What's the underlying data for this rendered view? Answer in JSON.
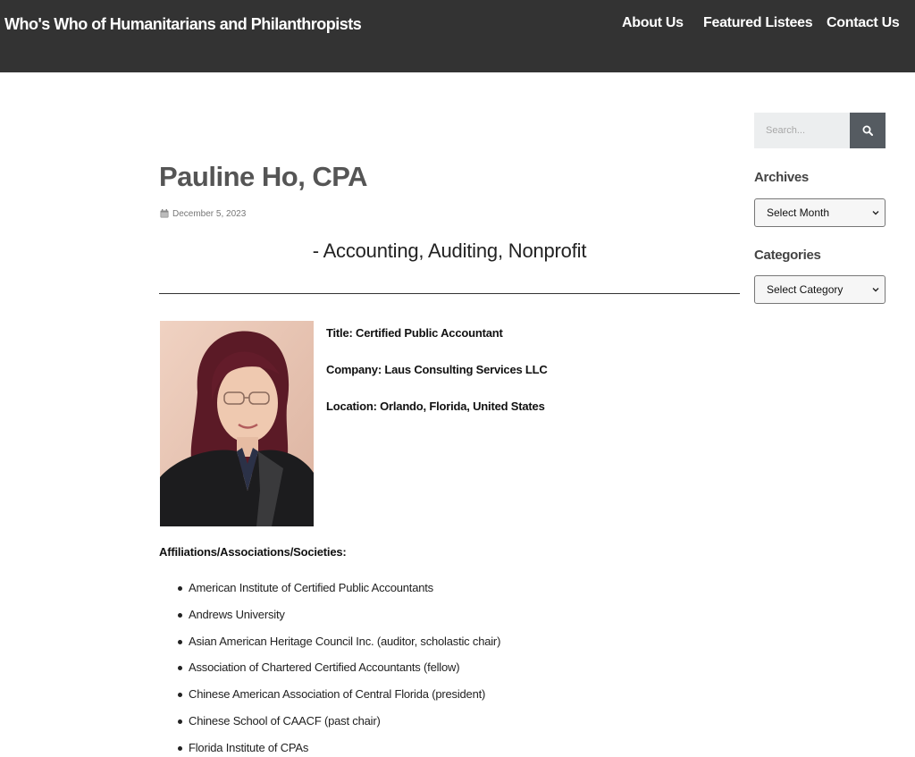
{
  "header": {
    "site_title": "Who's Who of Humanitarians and Philanthropists",
    "nav": [
      {
        "label": "About Us"
      },
      {
        "label": "Featured Listees"
      },
      {
        "label": "Contact Us"
      }
    ]
  },
  "post": {
    "title": "Pauline Ho, CPA",
    "date": "December 5, 2023",
    "date_icon": "calendar-icon",
    "subtitle": "- Accounting, Auditing, Nonprofit",
    "title_line": "Title: Certified Public Accountant",
    "company_line": "Company: Laus Consulting Services LLC",
    "location_line": "Location: Orlando, Florida, United States",
    "affiliations_heading": "Affiliations/Associations/Societies:",
    "affiliations": [
      "American Institute of Certified Public Accountants",
      "Andrews University",
      "Asian American Heritage Council Inc. (auditor, scholastic chair)",
      "Association of Chartered Certified Accountants (fellow)",
      "Chinese American Association of Central Florida (president)",
      "Chinese School of CAACF (past chair)",
      "Florida Institute of CPAs"
    ]
  },
  "sidebar": {
    "search": {
      "placeholder": "Search...",
      "icon": "search-icon"
    },
    "archives": {
      "heading": "Archives",
      "selected": "Select Month"
    },
    "categories": {
      "heading": "Categories",
      "selected": "Select Category"
    }
  },
  "colors": {
    "header_bg": "#333333",
    "search_button": "#555b61",
    "title_text": "#555555"
  }
}
